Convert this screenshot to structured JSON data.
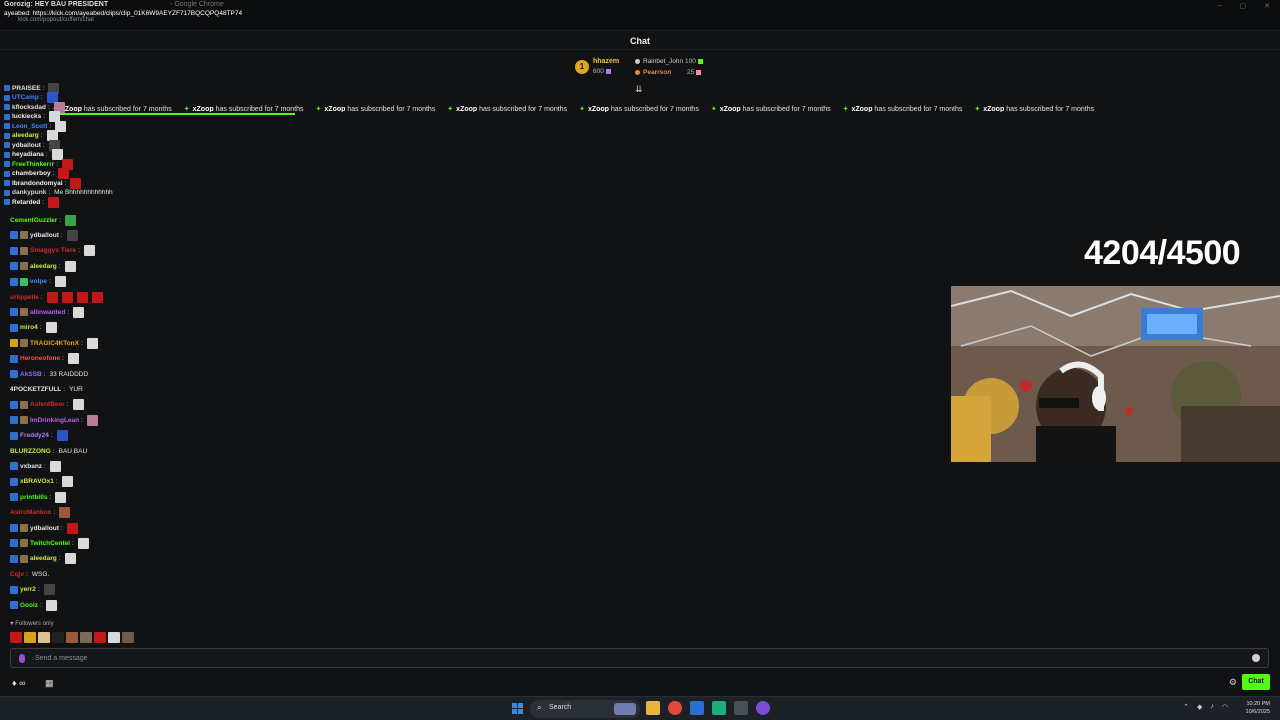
{
  "window": {
    "title": "Gorozig: HEY BAU PRESIDENT",
    "title_suffix": "- Google Chrome",
    "url": "ayeabed: https://kick.com/ayeabed/clips/clip_01K6W9AEYZF717BQCQPQ48TP74",
    "sub_url": "kick.com/popout/cuffem/chat",
    "controls": [
      "–",
      "▢",
      "✕"
    ]
  },
  "chat": {
    "title": "Chat"
  },
  "leaderboard": {
    "rank": "1",
    "first_name": "hhazem",
    "first_points": "600",
    "second_name": "Rainbet_John",
    "second_points": "100",
    "third_name": "Pearrson",
    "third_points": "25"
  },
  "ticker": {
    "user": "xZoop",
    "text": "has subscribed for 7 months",
    "repeat": 8,
    "progress_fraction": 0.2
  },
  "chaos_messages": [
    {
      "user": "PRAISEE",
      "color": "#e0e0e0",
      "text": "",
      "emote": "em-dark"
    },
    {
      "user": "UTCamp",
      "color": "#4a7cff",
      "text": "",
      "emote": "em-blue"
    },
    {
      "user": "kflocksdad",
      "color": "#e0e0e0",
      "text": "",
      "emote": "em-pink"
    },
    {
      "user": "luckiecks",
      "color": "#f1f1f1",
      "text": "",
      "emote": "em-bau"
    },
    {
      "user": "Leon_Scott",
      "color": "#3f8cff",
      "text": "",
      "emote": "em-bau"
    },
    {
      "user": "aleedarg",
      "color": "#c9e84a",
      "text": "",
      "emote": "em-bau"
    },
    {
      "user": "ydballout",
      "color": "#e0e0e0",
      "text": "",
      "emote": "em-dark"
    },
    {
      "user": "heyadiana",
      "color": "#f1f1f1",
      "text": "",
      "emote": "em-bau"
    },
    {
      "user": "FreeThinkerrr",
      "color": "#53fc18",
      "text": "",
      "emote": "em-red"
    },
    {
      "user": "chamberboy",
      "color": "#f1f1f1",
      "text": "",
      "emote": "em-red"
    },
    {
      "user": "lbrandondomyai",
      "color": "#f1f1f1",
      "text": "",
      "emote": "em-red"
    },
    {
      "user": "dankypunk",
      "color": "#d5d5d5",
      "text": "Me Bhhhhhhhhhhhh",
      "emote": ""
    },
    {
      "user": "Retarded",
      "color": "#f1f1f1",
      "text": "",
      "emote": "em-red"
    }
  ],
  "messages": [
    {
      "user": "CementGuzzler",
      "color": "#53fc18",
      "badges": [],
      "text": "",
      "emotes": [
        "em-green"
      ]
    },
    {
      "user": "ydballout",
      "color": "#e6e6e6",
      "badges": [
        "b-mod",
        "b-sub"
      ],
      "text": "",
      "emotes": [
        "em-dark"
      ]
    },
    {
      "user": "Smaggys Tiere",
      "color": "#d12b2b",
      "badges": [
        "b-mod",
        "b-sub"
      ],
      "text": "",
      "emotes": [
        "em-bau"
      ]
    },
    {
      "user": "aleedarg",
      "color": "#c9e84a",
      "badges": [
        "b-mod",
        "b-sub"
      ],
      "text": "",
      "emotes": [
        "em-bau"
      ]
    },
    {
      "user": "volpe",
      "color": "#4a8cff",
      "badges": [
        "b-mod",
        "b-gift"
      ],
      "text": "",
      "emotes": [
        "em-bau"
      ]
    },
    {
      "user": "urlippelle",
      "color": "#d12b2b",
      "badges": [],
      "text": "",
      "emotes": [
        "em-red",
        "em-red",
        "em-red",
        "em-red"
      ]
    },
    {
      "user": "allinwanted",
      "color": "#c15cff",
      "badges": [
        "b-mod",
        "b-sub"
      ],
      "text": "",
      "emotes": [
        "em-bau"
      ]
    },
    {
      "user": "miro4",
      "color": "#c9e84a",
      "badges": [
        "b-mod"
      ],
      "text": "",
      "emotes": [
        "em-bau"
      ]
    },
    {
      "user": "TRAGIC4KTonX",
      "color": "#f0a020",
      "badges": [
        "b-vip",
        "b-sub"
      ],
      "text": "",
      "emotes": [
        "em-bau"
      ]
    },
    {
      "user": "Heroneofone",
      "color": "#ff4d4d",
      "badges": [
        "b-mod"
      ],
      "text": "",
      "emotes": [
        "em-bau"
      ]
    },
    {
      "user": "AkSSB",
      "color": "#8a6fff",
      "badges": [
        "b-mod"
      ],
      "text": "33 RAIDDDD",
      "emotes": []
    },
    {
      "user": "4POCKETZFULL",
      "color": "#e6e6e6",
      "badges": [],
      "text": "YUR",
      "emotes": []
    },
    {
      "user": "AsfentBeer",
      "color": "#d12b2b",
      "badges": [
        "b-mod",
        "b-sub"
      ],
      "text": "",
      "emotes": [
        "em-bau"
      ]
    },
    {
      "user": "ImDrinkingLean",
      "color": "#c15cff",
      "badges": [
        "b-mod",
        "b-sub"
      ],
      "text": "",
      "emotes": [
        "em-pink"
      ]
    },
    {
      "user": "Freddy24",
      "color": "#b07bff",
      "badges": [
        "b-mod"
      ],
      "text": "",
      "emotes": [
        "em-blue"
      ]
    },
    {
      "user": "BLURZZONG",
      "color": "#c9e84a",
      "badges": [],
      "text": "BAU BAU",
      "emotes": []
    },
    {
      "user": "vxbanz",
      "color": "#e6e6e6",
      "badges": [
        "b-mod"
      ],
      "text": "",
      "emotes": [
        "em-bau"
      ]
    },
    {
      "user": "xBRAVOx1",
      "color": "#c9e84a",
      "badges": [
        "b-mod"
      ],
      "text": "",
      "emotes": [
        "em-bau"
      ]
    },
    {
      "user": "printbills",
      "color": "#53fc18",
      "badges": [
        "b-mod"
      ],
      "text": "",
      "emotes": [
        "em-bau"
      ]
    },
    {
      "user": "AstroMankoo",
      "color": "#d12b2b",
      "badges": [],
      "text": "",
      "emotes": [
        "em-bro"
      ]
    },
    {
      "user": "ydballout",
      "color": "#e6e6e6",
      "badges": [
        "b-mod",
        "b-sub"
      ],
      "text": "",
      "emotes": [
        "em-red"
      ]
    },
    {
      "user": "TwitchCentel",
      "color": "#53fc18",
      "badges": [
        "b-mod",
        "b-sub"
      ],
      "text": "",
      "emotes": [
        "em-bau"
      ]
    },
    {
      "user": "aleedarg",
      "color": "#c9e84a",
      "badges": [
        "b-mod",
        "b-sub"
      ],
      "text": "",
      "emotes": [
        "em-bau"
      ]
    },
    {
      "user": "Cqjv",
      "color": "#d12b2b",
      "badges": [],
      "text": "WSG.",
      "emotes": []
    },
    {
      "user": "yerr2",
      "color": "#c9e84a",
      "badges": [
        "b-mod"
      ],
      "text": "",
      "emotes": [
        "em-dark"
      ]
    },
    {
      "user": "Goolz",
      "color": "#53fc18",
      "badges": [
        "b-mod"
      ],
      "text": "",
      "emotes": [
        "em-bau"
      ]
    }
  ],
  "followers_only": "♥ Followers only",
  "emote_bar": [
    "#c21818",
    "#d6a21a",
    "#e0c090",
    "#222",
    "#9b5a37",
    "#7a6a5a",
    "#c21818",
    "#d9d9d9",
    "#6b5a4e"
  ],
  "input": {
    "placeholder": "Send a message"
  },
  "actions": {
    "left_label": "∞",
    "chat_button": "Chat"
  },
  "overlay": {
    "counter": "4204/4500"
  },
  "taskbar": {
    "search": "Search",
    "time": "10:20 PM",
    "date": "10/6/2025"
  },
  "colors": {
    "accent": "#53fc18",
    "background": "#111214"
  }
}
